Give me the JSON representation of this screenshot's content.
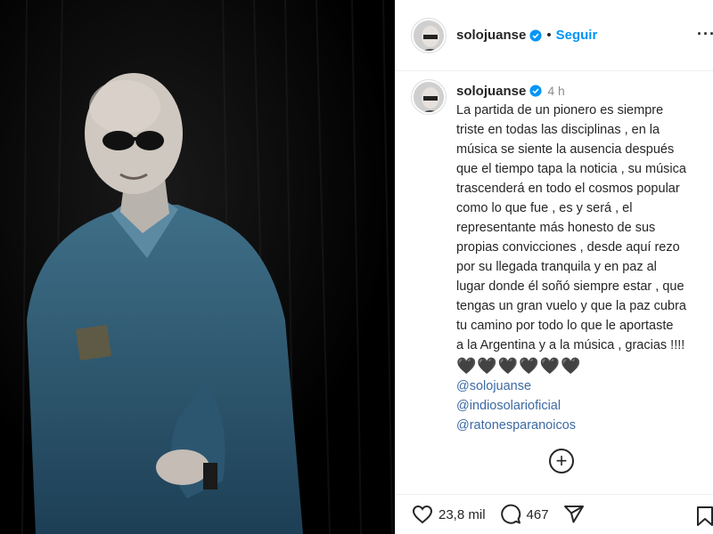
{
  "post": {
    "username": "solojuanse",
    "follow_label": "Seguir",
    "separator": "•",
    "time": "4 h",
    "caption": "La partida de un pionero es siempre\ntriste en todas las disciplinas , en la\nmúsica se siente la ausencia después\nque el tiempo tapa la noticia , su música\ntrascenderá en todo el cosmos popular\ncomo lo que fue , es y será , el\nrepresentante más honesto de sus\npropias convicciones , desde aquí rezo\npor su llegada tranquila y en paz al\nlugar donde él soñó siempre estar , que\ntengas un gran vuelo y que la paz cubra\ntu camino por todo lo que le aportaste\na la Argentina y a la música , gracias !!!!",
    "hearts": "🖤🖤🖤🖤🖤🖤",
    "mentions": [
      "@solojuanse",
      "@indiosolarioficial",
      "@ratonesparanoicos"
    ],
    "likes": "23,8 mil",
    "comments": "467"
  },
  "icons": {
    "more": "more-options-icon",
    "load_more": "add-circle-icon",
    "like": "heart-icon",
    "comment": "comment-icon",
    "share": "share-icon",
    "save": "bookmark-icon",
    "verified": "verified-badge-icon"
  },
  "colors": {
    "accent": "#0095f6",
    "mention": "#3d6aa3",
    "muted": "#8e8e8e",
    "verified": "#0095f6"
  }
}
